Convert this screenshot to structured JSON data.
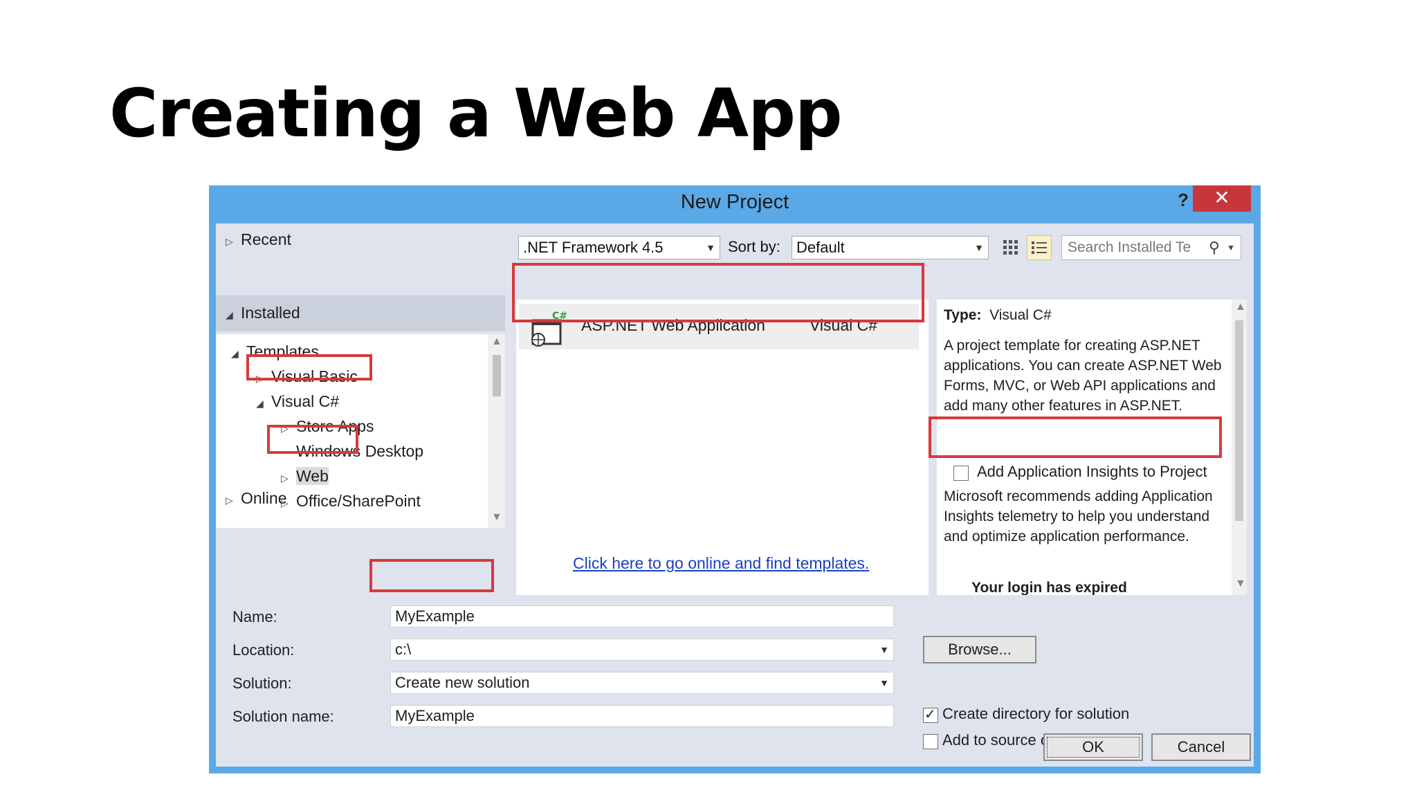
{
  "slide": {
    "title": "Creating a Web App"
  },
  "dialog": {
    "title": "New Project",
    "help": "?",
    "close": "✕"
  },
  "nav": {
    "recent": "Recent",
    "installed": "Installed",
    "templates": "Templates",
    "visual_basic": "Visual Basic",
    "visual_csharp": "Visual C#",
    "store_apps": "Store Apps",
    "windows_desktop": "Windows Desktop",
    "web": "Web",
    "office_sharepoint": "Office/SharePoint",
    "online": "Online"
  },
  "toolbar": {
    "framework": ".NET Framework 4.5",
    "sort_by_label": "Sort by:",
    "sort_value": "Default",
    "search_placeholder": "Search Installed Te"
  },
  "templates": [
    {
      "name": "ASP.NET Web Application",
      "language": "Visual C#",
      "badge": "C#"
    }
  ],
  "online_link": "Click here to go online and find templates.",
  "details": {
    "type_label": "Type:",
    "type_value": "Visual C#",
    "description": "A project template for creating ASP.NET applications. You can create ASP.NET Web Forms, MVC,  or Web API applications and add many other features in ASP.NET.",
    "insights_label": "Add Application Insights to Project",
    "insights_checked": false,
    "insights_note": "Microsoft recommends adding Application Insights telemetry to help you understand and optimize application performance.",
    "cut_text": "Your login has expired"
  },
  "form": {
    "name_label": "Name:",
    "name_value": "MyExample",
    "location_label": "Location:",
    "location_value": "c:\\",
    "browse": "Browse...",
    "solution_label": "Solution:",
    "solution_value": "Create new solution",
    "solution_name_label": "Solution name:",
    "solution_name_value": "MyExample",
    "create_directory_label": "Create directory for solution",
    "create_directory_checked": true,
    "source_control_label": "Add to source control",
    "source_control_checked": false,
    "ok": "OK",
    "cancel": "Cancel"
  },
  "colors": {
    "highlight": "#d8393b",
    "dialog_frame": "#5aa9e6",
    "close_button": "#c7363a",
    "link": "#1a3fbf"
  }
}
